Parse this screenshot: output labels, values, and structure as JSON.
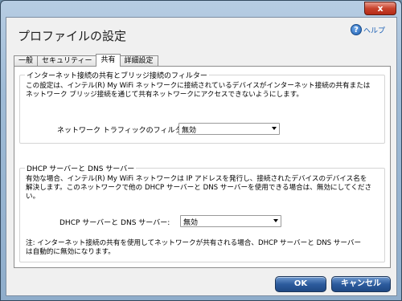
{
  "window": {
    "close_glyph": "x"
  },
  "dialog": {
    "title": "プロファイルの設定",
    "help_label": "ヘルプ",
    "help_glyph": "?"
  },
  "tabs": [
    "一般",
    "セキュリティー",
    "共有",
    "詳細設定"
  ],
  "active_tab": "共有",
  "sharing_group": {
    "label": "インターネット接続の共有とブリッジ接続のフィルター",
    "description_line1": "この設定は、インテル(R) My WiFi ネットワークに接続されているデバイスがインターネット接続の共有または",
    "description_line2": "ネットワーク ブリッジ接続を通じて共有ネットワークにアクセスできないようにします。",
    "filter_label": "ネットワーク トラフィックのフィルター:",
    "filter_value": "無効"
  },
  "dhcp_group": {
    "label": "DHCP サーバーと DNS サーバー",
    "description_line1": "有効な場合、インテル(R) My WiFi ネットワークは IP アドレスを発行し、接続されたデバイスのデバイス名を",
    "description_line2": "解決します。このネットワークで他の DHCP サーバーと DNS サーバーを使用できる場合は、無効にしてくださ",
    "description_line3": "い。",
    "server_label": "DHCP サーバーと DNS サーバー:",
    "server_value": "無効",
    "note_line1": "注: インターネット接続の共有を使用してネットワークが共有される場合、DHCP サーバーと DNS サーバー",
    "note_line2": "は自動的に無効になります。"
  },
  "buttons": {
    "ok": "OK",
    "cancel": "キャンセル"
  }
}
